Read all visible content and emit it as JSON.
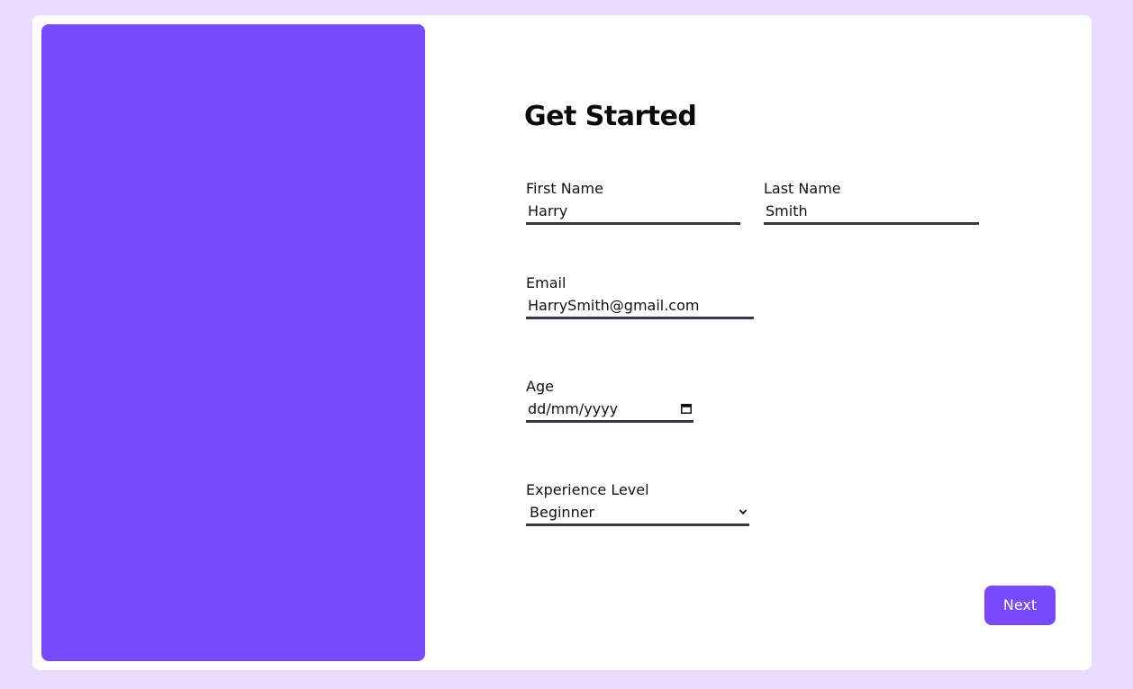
{
  "form": {
    "title": "Get Started",
    "first_name": {
      "label": "First Name",
      "value": "Harry"
    },
    "last_name": {
      "label": "Last Name",
      "value": "Smith"
    },
    "email": {
      "label": "Email",
      "value": "HarrySmith@gmail.com"
    },
    "age": {
      "label": "Age",
      "placeholder": "dd/mm/yyyy",
      "icon": "calendar-icon"
    },
    "experience": {
      "label": "Experience Level",
      "selected": "Beginner",
      "icon": "chevron-down-icon"
    },
    "next_label": "Next"
  },
  "colors": {
    "background": "#e8dcff",
    "accent": "#7849ff",
    "card": "#ffffff",
    "field_underline": "#3a3645"
  }
}
